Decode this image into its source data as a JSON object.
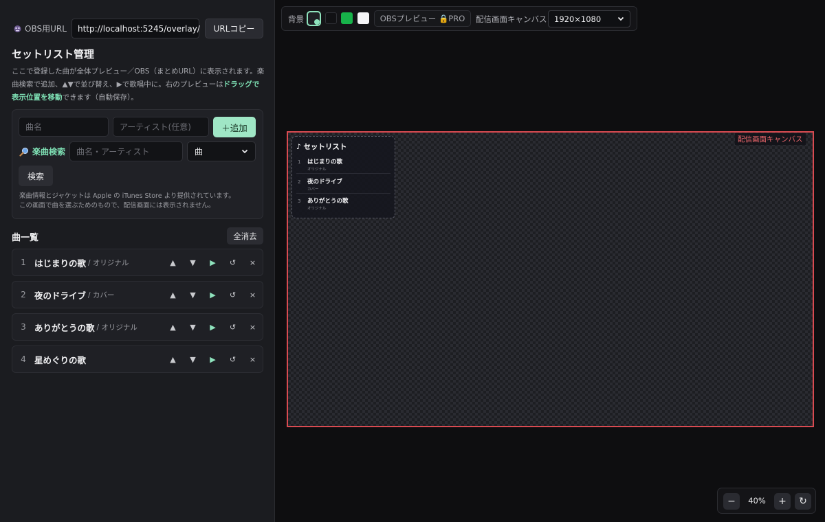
{
  "sidebar": {
    "obs_url_label": "OBS用URL",
    "obs_url_value": "http://localhost:5245/overlay/",
    "url_copy_label": "URLコピー",
    "title": "セットリスト管理",
    "desc_part1": "ここで登録した曲が全体プレビュー／OBS（まとめURL）に表示されます。楽曲検索で追加、▲▼で並び替え、▶で歌唱中に。右のプレビューは",
    "desc_highlight": "ドラッグで表示位置を移動",
    "desc_part2": "できます（自動保存）。",
    "form": {
      "song_placeholder": "曲名",
      "artist_placeholder": "アーティスト(任意)",
      "add_label": "＋追加",
      "search_label": "楽曲検索",
      "search_placeholder": "曲名・アーティスト",
      "search_type": "曲",
      "search_button": "検索",
      "credit_line1": "楽曲情報とジャケットは Apple の iTunes Store より提供されています。",
      "credit_line2": "この画面で曲を選ぶためのもので、配信画面には表示されません。"
    },
    "list_title": "曲一覧",
    "clear_all": "全消去",
    "songs": [
      {
        "index": "1",
        "name": "はじまりの歌",
        "sub": "/ オリジナル"
      },
      {
        "index": "2",
        "name": "夜のドライブ",
        "sub": "/ カバー"
      },
      {
        "index": "3",
        "name": "ありがとうの歌",
        "sub": "/ オリジナル"
      },
      {
        "index": "4",
        "name": "星めぐりの歌",
        "sub": ""
      }
    ],
    "controls": {
      "up": "▲",
      "down": "▼",
      "play": "▶",
      "reset": "↺",
      "remove": "×"
    }
  },
  "toolbar": {
    "bg_label": "背景",
    "swatch_colors": [
      "#1e1f24",
      "#111114",
      "#17b34a",
      "#f5f5f7"
    ],
    "obs_preview": "OBSプレビュー 🔒PRO",
    "canvas_label": "配信画面キャンバス",
    "resolution": "1920×1080"
  },
  "canvas": {
    "label": "配信画面キャンバス",
    "border_color": "#d94b51"
  },
  "overlay": {
    "title": "♪ セットリスト",
    "items": [
      {
        "n": "1",
        "title": "はじまりの歌",
        "sub": "オリジナル"
      },
      {
        "n": "2",
        "title": "夜のドライブ",
        "sub": "カバー"
      },
      {
        "n": "3",
        "title": "ありがとうの歌",
        "sub": "オリジナル"
      }
    ]
  },
  "zoom": {
    "minus": "−",
    "value": "40%",
    "plus": "+",
    "reset": "↻"
  }
}
